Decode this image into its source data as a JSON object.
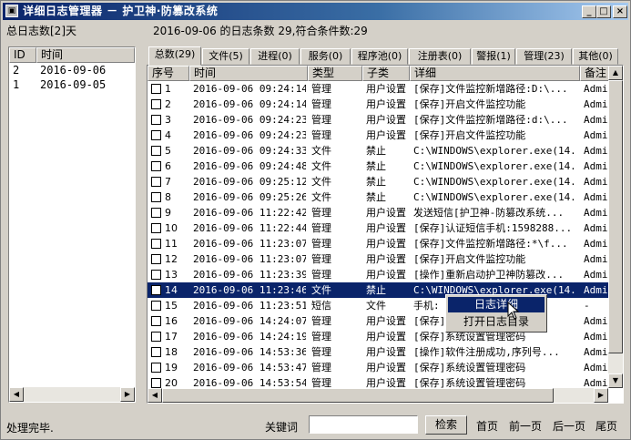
{
  "window": {
    "title": "详细日志管理器 － 护卫神·防篡改系统",
    "icon": "app-icon"
  },
  "summary": {
    "total_days": "总日志数[2]天",
    "stats": "2016-09-06 的日志条数 29,符合条件数:29"
  },
  "days": {
    "columns": [
      "ID",
      "时间"
    ],
    "rows": [
      {
        "id": "2",
        "date": "2016-09-06"
      },
      {
        "id": "1",
        "date": "2016-09-05"
      }
    ]
  },
  "tabs": [
    "总数(29)",
    "文件(5)",
    "进程(0)",
    "服务(0)",
    "程序池(0)",
    "注册表(0)",
    "警报(1)",
    "管理(23)",
    "其他(0)"
  ],
  "log_table": {
    "columns": [
      "序号",
      "时间",
      "类型",
      "子类",
      "详细",
      "备注"
    ],
    "rows": [
      {
        "no": "1",
        "time": "2016-09-06 09:24:14",
        "type": "管理",
        "sub": "用户设置",
        "detail": "[保存]文件监控新增路径:D:\\...",
        "note": "Admi"
      },
      {
        "no": "2",
        "time": "2016-09-06 09:24:14",
        "type": "管理",
        "sub": "用户设置",
        "detail": "[保存]开启文件监控功能",
        "note": "Admi"
      },
      {
        "no": "3",
        "time": "2016-09-06 09:24:23",
        "type": "管理",
        "sub": "用户设置",
        "detail": "[保存]文件监控新增路径:d:\\...",
        "note": "Admi"
      },
      {
        "no": "4",
        "time": "2016-09-06 09:24:23",
        "type": "管理",
        "sub": "用户设置",
        "detail": "[保存]开启文件监控功能",
        "note": "Admi"
      },
      {
        "no": "5",
        "time": "2016-09-06 09:24:33",
        "type": "文件",
        "sub": "禁止",
        "detail": "C:\\WINDOWS\\explorer.exe(14...",
        "note": "Admi"
      },
      {
        "no": "6",
        "time": "2016-09-06 09:24:48",
        "type": "文件",
        "sub": "禁止",
        "detail": "C:\\WINDOWS\\explorer.exe(14...",
        "note": "Admi"
      },
      {
        "no": "7",
        "time": "2016-09-06 09:25:12",
        "type": "文件",
        "sub": "禁止",
        "detail": "C:\\WINDOWS\\explorer.exe(14...",
        "note": "Admi"
      },
      {
        "no": "8",
        "time": "2016-09-06 09:25:26",
        "type": "文件",
        "sub": "禁止",
        "detail": "C:\\WINDOWS\\explorer.exe(14...",
        "note": "Admi"
      },
      {
        "no": "9",
        "time": "2016-09-06 11:22:42",
        "type": "管理",
        "sub": "用户设置",
        "detail": "发送短信[护卫神-防篡改系统...",
        "note": "Admi"
      },
      {
        "no": "10",
        "time": "2016-09-06 11:22:44",
        "type": "管理",
        "sub": "用户设置",
        "detail": "[保存]认证短信手机:1598288...",
        "note": "Admi"
      },
      {
        "no": "11",
        "time": "2016-09-06 11:23:07",
        "type": "管理",
        "sub": "用户设置",
        "detail": "[保存]文件监控新增路径:*\\f...",
        "note": "Admi"
      },
      {
        "no": "12",
        "time": "2016-09-06 11:23:07",
        "type": "管理",
        "sub": "用户设置",
        "detail": "[保存]开启文件监控功能",
        "note": "Admi"
      },
      {
        "no": "13",
        "time": "2016-09-06 11:23:39",
        "type": "管理",
        "sub": "用户设置",
        "detail": "[操作]重新启动护卫神防篡改...",
        "note": "Admi"
      },
      {
        "no": "14",
        "time": "2016-09-06 11:23:46",
        "type": "文件",
        "sub": "禁止",
        "detail": "C:\\WINDOWS\\explorer.exe(14...",
        "note": "Admi"
      },
      {
        "no": "15",
        "time": "2016-09-06 11:23:51",
        "type": "短信",
        "sub": "文件",
        "detail": "手机:",
        "note": "-"
      },
      {
        "no": "16",
        "time": "2016-09-06 14:24:07",
        "type": "管理",
        "sub": "用户设置",
        "detail": "[保存]",
        "note": "Admi"
      },
      {
        "no": "17",
        "time": "2016-09-06 14:24:19",
        "type": "管理",
        "sub": "用户设置",
        "detail": "[保存]系统设置管理密码",
        "note": "Admi"
      },
      {
        "no": "18",
        "time": "2016-09-06 14:53:36",
        "type": "管理",
        "sub": "用户设置",
        "detail": "[操作]软件注册成功,序列号...",
        "note": "Admi"
      },
      {
        "no": "19",
        "time": "2016-09-06 14:53:47",
        "type": "管理",
        "sub": "用户设置",
        "detail": "[保存]系统设置管理密码",
        "note": "Admi"
      },
      {
        "no": "20",
        "time": "2016-09-06 14:53:54",
        "type": "管理",
        "sub": "用户设置",
        "detail": "[保存]系统设置管理密码",
        "note": "Admi"
      }
    ]
  },
  "context_menu": [
    "日志详细",
    "打开日志目录"
  ],
  "status": {
    "text": "处理完毕."
  },
  "search": {
    "label": "关键词",
    "value": "",
    "button": "检索"
  },
  "pager": {
    "first": "首页",
    "prev": "前一页",
    "next": "后一页",
    "last": "尾页"
  },
  "colors": {
    "title_start": "#0a246a",
    "title_end": "#a6caf0",
    "selection": "#0a246a",
    "face": "#d4d0c8"
  },
  "icons": {
    "minimize": "minimize-icon",
    "maximize": "maximize-icon",
    "close": "close-icon"
  }
}
